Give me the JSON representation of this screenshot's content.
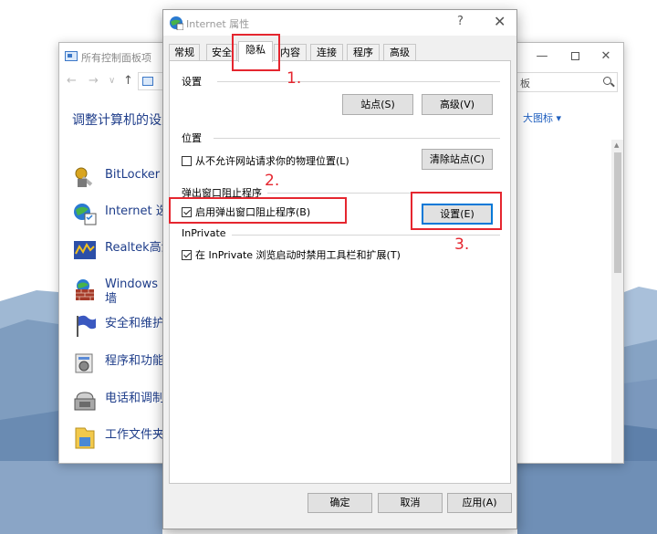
{
  "background_window": {
    "title": "所有控制面板项",
    "search_placeholder": "板",
    "heading": "调整计算机的设置",
    "view_label": "大图标 ▾",
    "items": [
      {
        "label": "BitLocker 驱",
        "icon": "bitlocker-key-icon"
      },
      {
        "label": "Internet 选",
        "icon": "internet-options-icon"
      },
      {
        "label": "Realtek高清",
        "icon": "realtek-audio-icon"
      },
      {
        "label": "Windows D",
        "label2": "墙",
        "icon": "firewall-icon"
      },
      {
        "label": "安全和维护",
        "icon": "security-flag-icon"
      },
      {
        "label": "程序和功能",
        "icon": "programs-icon"
      },
      {
        "label": "电话和调制",
        "icon": "phone-modem-icon"
      },
      {
        "label": "工作文件夹",
        "icon": "work-folders-icon"
      }
    ]
  },
  "dialog": {
    "title": "Internet 属性",
    "help": "?",
    "close": "✕",
    "tabs": [
      "常规",
      "安全",
      "隐私",
      "内容",
      "连接",
      "程序",
      "高级"
    ],
    "active_tab": "隐私",
    "settings_group": {
      "title": "设置",
      "sites_button": "站点(S)",
      "advanced_button": "高级(V)"
    },
    "location_group": {
      "title": "位置",
      "checkbox_label": "从不允许网站请求你的物理位置(L)",
      "checked": false,
      "clear_sites_button": "清除站点(C)"
    },
    "popup_group": {
      "title": "弹出窗口阻止程序",
      "checkbox_label": "启用弹出窗口阻止程序(B)",
      "checked": true,
      "settings_button": "设置(E)"
    },
    "inprivate_group": {
      "title": "InPrivate",
      "checkbox_label": "在 InPrivate 浏览启动时禁用工具栏和扩展(T)",
      "checked": true
    },
    "footer": {
      "ok": "确定",
      "cancel": "取消",
      "apply": "应用(A)"
    }
  },
  "annotations": {
    "step1": "1.",
    "step2": "2.",
    "step3": "3.",
    "color": "#e5262f"
  }
}
